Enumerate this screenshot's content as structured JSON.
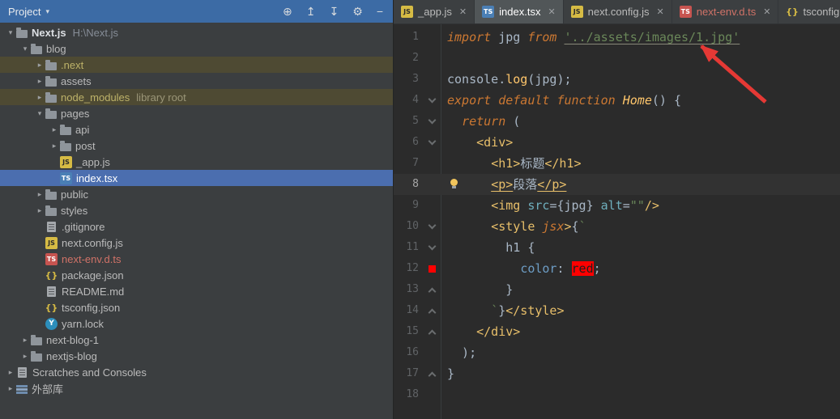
{
  "colors": {
    "selection_blue": "#4b6eaf",
    "excluded_row_olive": "#4e4a33",
    "panel_header_blue": "#3c6ba5",
    "error_file_text": "#d07267",
    "annotation_red": "#e53935"
  },
  "icons": {
    "chevron_expanded": "▾",
    "chevron_collapsed": "▸",
    "js_badge": "JS",
    "ts_badge": "TS",
    "json_badge": "{}",
    "yarn_badge": "Y",
    "close_glyph": "✕",
    "header_glyphs": {
      "locate-file": "⊕",
      "collapse-all": "↥",
      "expand-all": "↧",
      "settings": "⚙",
      "hide": "−"
    }
  },
  "project_panel": {
    "header": {
      "title": "Project",
      "icons": [
        "locate-file",
        "collapse-all",
        "expand-all",
        "settings",
        "hide"
      ]
    },
    "tree": [
      {
        "label": "Next.js",
        "hint": "H:\\Next.js",
        "level": 0,
        "chevron": "expanded",
        "icon": "folder",
        "bold": true
      },
      {
        "label": "blog",
        "level": 1,
        "chevron": "expanded",
        "icon": "folder"
      },
      {
        "label": ".next",
        "level": 2,
        "chevron": "collapsed",
        "icon": "folder",
        "row": "excluded"
      },
      {
        "label": "assets",
        "level": 2,
        "chevron": "collapsed",
        "icon": "folder"
      },
      {
        "label": "node_modules",
        "hint": "library root",
        "level": 2,
        "chevron": "collapsed",
        "icon": "folder",
        "row": "excluded"
      },
      {
        "label": "pages",
        "level": 2,
        "chevron": "expanded",
        "icon": "folder"
      },
      {
        "label": "api",
        "level": 3,
        "chevron": "collapsed",
        "icon": "folder"
      },
      {
        "label": "post",
        "level": 3,
        "chevron": "collapsed",
        "icon": "folder"
      },
      {
        "label": "_app.js",
        "level": 3,
        "icon": "js"
      },
      {
        "label": "index.tsx",
        "level": 3,
        "icon": "ts",
        "row": "selected"
      },
      {
        "label": "public",
        "level": 2,
        "chevron": "collapsed",
        "icon": "folder"
      },
      {
        "label": "styles",
        "level": 2,
        "chevron": "collapsed",
        "icon": "folder"
      },
      {
        "label": ".gitignore",
        "level": 2,
        "icon": "doc"
      },
      {
        "label": "next.config.js",
        "level": 2,
        "icon": "js"
      },
      {
        "label": "next-env.d.ts",
        "level": 2,
        "icon": "ts-red",
        "text": "error"
      },
      {
        "label": "package.json",
        "level": 2,
        "icon": "json"
      },
      {
        "label": "README.md",
        "level": 2,
        "icon": "doc"
      },
      {
        "label": "tsconfig.json",
        "level": 2,
        "icon": "json"
      },
      {
        "label": "yarn.lock",
        "level": 2,
        "icon": "yarn"
      },
      {
        "label": "next-blog-1",
        "level": 1,
        "chevron": "collapsed",
        "icon": "folder"
      },
      {
        "label": "nextjs-blog",
        "level": 1,
        "chevron": "collapsed",
        "icon": "folder"
      },
      {
        "label": "Scratches and Consoles",
        "level": 0,
        "chevron": "collapsed",
        "icon": "scratch"
      },
      {
        "label": "外部库",
        "name": "external-libraries",
        "level": 0,
        "chevron": "collapsed",
        "icon": "lib"
      }
    ]
  },
  "editor": {
    "tabs": [
      {
        "label": "_app.js",
        "icon": "js"
      },
      {
        "label": "index.tsx",
        "icon": "ts",
        "active": true
      },
      {
        "label": "next.config.js",
        "icon": "js"
      },
      {
        "label": "next-env.d.ts",
        "icon": "ts-red",
        "text": "error"
      },
      {
        "label": "tsconfig.json",
        "icon": "json"
      }
    ],
    "current_line": 8,
    "lines": [
      {
        "n": 1,
        "seg": [
          [
            "import ",
            "kw"
          ],
          [
            "jpg ",
            "p"
          ],
          [
            "from ",
            "kw"
          ],
          [
            "'../assets/images/1.jpg'",
            "stru"
          ]
        ]
      },
      {
        "n": 2,
        "seg": []
      },
      {
        "n": 3,
        "seg": [
          [
            "console.",
            "p"
          ],
          [
            "log",
            "fn"
          ],
          [
            "(jpg);",
            "p"
          ]
        ]
      },
      {
        "n": 4,
        "fold": "open",
        "seg": [
          [
            "export default ",
            "kw"
          ],
          [
            "function ",
            "kw"
          ],
          [
            "Home",
            "fni"
          ],
          [
            "() {",
            "p"
          ]
        ]
      },
      {
        "n": 5,
        "fold": "open",
        "seg": [
          [
            "  ",
            "p"
          ],
          [
            "return",
            "kw"
          ],
          [
            " (",
            "p"
          ]
        ]
      },
      {
        "n": 6,
        "fold": "open",
        "seg": [
          [
            "    ",
            "p"
          ],
          [
            "<div>",
            "tag"
          ]
        ]
      },
      {
        "n": 7,
        "seg": [
          [
            "      ",
            "p"
          ],
          [
            "<h1>",
            "tag"
          ],
          [
            "标题",
            "p"
          ],
          [
            "</h1>",
            "tag"
          ]
        ]
      },
      {
        "n": 8,
        "bulb": true,
        "seg": [
          [
            "      ",
            "p"
          ],
          [
            "<p>",
            "tagu"
          ],
          [
            "段落",
            "p"
          ],
          [
            "</p>",
            "tagu"
          ]
        ]
      },
      {
        "n": 9,
        "seg": [
          [
            "      ",
            "p"
          ],
          [
            "<img ",
            "tag"
          ],
          [
            "src",
            "attr"
          ],
          [
            "={jpg} ",
            "p"
          ],
          [
            "alt",
            "attr"
          ],
          [
            "=",
            "p"
          ],
          [
            "\"\"",
            "str"
          ],
          [
            "/>",
            "tag"
          ]
        ]
      },
      {
        "n": 10,
        "fold": "open",
        "seg": [
          [
            "      ",
            "p"
          ],
          [
            "<style ",
            "tag"
          ],
          [
            "jsx",
            "kw"
          ],
          [
            ">",
            "tag"
          ],
          [
            "{",
            "p"
          ],
          [
            "`",
            "str"
          ]
        ]
      },
      {
        "n": 11,
        "fold": "open",
        "seg": [
          [
            "        h1 {",
            "p"
          ]
        ]
      },
      {
        "n": 12,
        "swatch": "#ff0000",
        "seg": [
          [
            "          ",
            "p"
          ],
          [
            "color",
            "prop"
          ],
          [
            ": ",
            "p"
          ],
          [
            "red",
            "red"
          ],
          [
            ";",
            "p"
          ]
        ]
      },
      {
        "n": 13,
        "fold": "close",
        "seg": [
          [
            "        }",
            "p"
          ]
        ]
      },
      {
        "n": 14,
        "fold": "close",
        "seg": [
          [
            "      ",
            "p"
          ],
          [
            "`",
            "str"
          ],
          [
            "}",
            "p"
          ],
          [
            "</style>",
            "tag"
          ]
        ]
      },
      {
        "n": 15,
        "fold": "close",
        "seg": [
          [
            "    ",
            "p"
          ],
          [
            "</div>",
            "tag"
          ]
        ]
      },
      {
        "n": 16,
        "seg": [
          [
            "  );",
            "p"
          ]
        ]
      },
      {
        "n": 17,
        "fold": "close",
        "seg": [
          [
            "}",
            "p"
          ]
        ]
      },
      {
        "n": 18,
        "seg": []
      }
    ]
  },
  "annotation": {
    "name": "red-arrow",
    "color": "#e53935"
  }
}
